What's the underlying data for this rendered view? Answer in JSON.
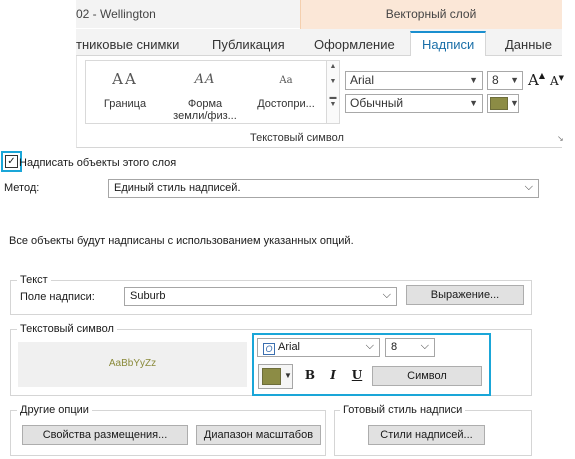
{
  "ribbon": {
    "title": "02 - Wellington",
    "context_title": "Векторный слой",
    "tabs": [
      {
        "label": "тниковые снимки"
      },
      {
        "label": "Публикация"
      },
      {
        "label": "Оформление"
      },
      {
        "label": "Надписи"
      },
      {
        "label": "Данные"
      }
    ],
    "active_tab": "Надписи",
    "gallery": {
      "items": [
        {
          "sample": "AA",
          "label": "Граница"
        },
        {
          "sample": "AA",
          "label": "Форма земли/физ..."
        },
        {
          "sample": "Aa",
          "label": "Достопри..."
        }
      ]
    },
    "font_name": "Arial",
    "font_style": "Обычный",
    "font_size": "8",
    "grow_font": "A",
    "shrink_font": "A",
    "color_swatch": "#8c8c45",
    "group_label": "Текстовый символ"
  },
  "dialog": {
    "label_checkbox": {
      "label": "Надписать объекты этого слоя",
      "checked": true
    },
    "method_label": "Метод:",
    "method_value": "Единый стиль надписей.",
    "info_text": "Все объекты будут надписаны с использованием указанных опций.",
    "text_section": {
      "title": "Текст",
      "field_label": "Поле надписи:",
      "field_value": "Suburb",
      "expression_button": "Выражение..."
    },
    "symbol_section": {
      "title": "Текстовый символ",
      "preview_text": "AaBbYyZz",
      "preview_color": "#8c8c45",
      "font_name": "Arial",
      "font_size": "8",
      "color_swatch": "#8c8c45",
      "bold_label": "B",
      "italic_label": "I",
      "underline_label": "U",
      "symbol_button": "Символ"
    },
    "other_options": {
      "title": "Другие опции",
      "placement_button": "Свойства размещения...",
      "scale_button": "Диапазон масштабов"
    },
    "label_style": {
      "title": "Готовый стиль надписи",
      "styles_button": "Стили надписей..."
    },
    "highlight_color": "#1aa6d8"
  }
}
